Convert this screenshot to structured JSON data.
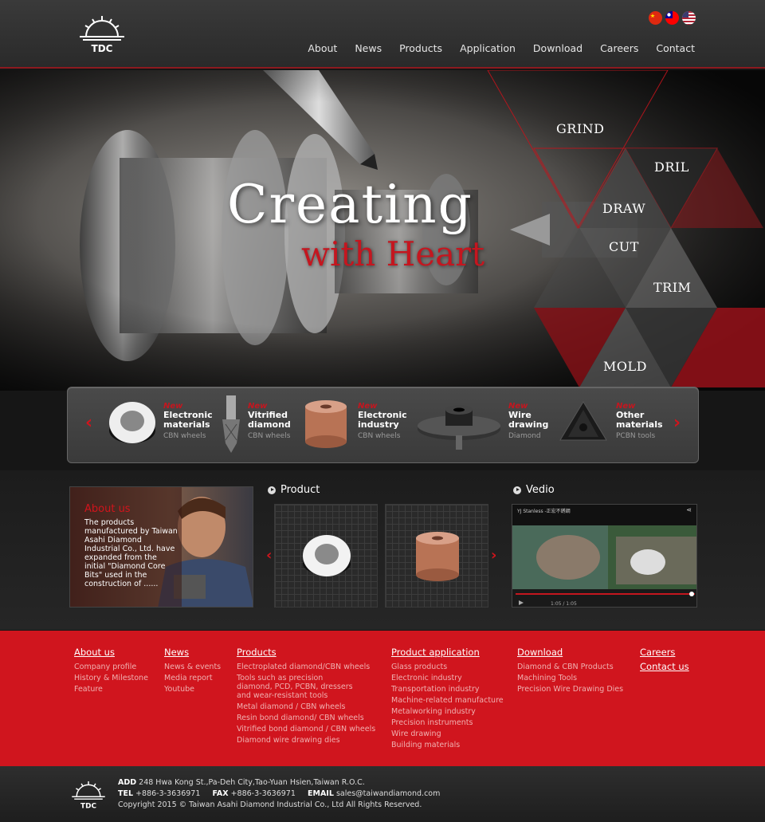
{
  "header": {
    "logo_text": "TDC",
    "nav": [
      "About",
      "News",
      "Products",
      "Application",
      "Download",
      "Careers",
      "Contact"
    ]
  },
  "hero": {
    "title": "Creating",
    "subtitle": "with Heart",
    "process_words": [
      "GRIND",
      "DRIL",
      "DRAW",
      "CUT",
      "TRIM",
      "MOLD"
    ]
  },
  "slider": {
    "prev": "‹",
    "next": "›",
    "new_label": "New",
    "items": [
      {
        "title_1": "Electronic",
        "title_2": "materials",
        "sub": "CBN wheels"
      },
      {
        "title_1": "Vitrified",
        "title_2": "diamond",
        "sub": "CBN wheels"
      },
      {
        "title_1": "Electronic",
        "title_2": "industry",
        "sub": "CBN wheels"
      },
      {
        "title_1": "Wire",
        "title_2": "drawing",
        "sub": "Diamond"
      },
      {
        "title_1": "Other",
        "title_2": "materials",
        "sub": "PCBN tools"
      }
    ]
  },
  "about": {
    "title": "About us",
    "text": "The products manufactured by Taiwan Asahi Diamond Industrial Co., Ltd. have expanded from the initial \"Diamond Core Bits\" used in the construction of ......"
  },
  "product_section": {
    "title": "Product",
    "prev": "‹",
    "next": "›"
  },
  "video_section": {
    "title": "Vedio",
    "video_title": "YJ Stanless -正宏不銹鋼",
    "time": "1:05 / 1:05"
  },
  "footer_nav": {
    "columns": [
      {
        "head": "About us",
        "links": [
          "Company profile",
          "History & Milestone",
          "Feature"
        ]
      },
      {
        "head": "News",
        "links": [
          "News & events",
          "Media report",
          "Youtube"
        ]
      },
      {
        "head": "Products",
        "links": [
          "Electroplated diamond/CBN wheels",
          "Tools such as precision",
          "diamond, PCD, PCBN, dressers",
          "and wear-resistant tools",
          "Metal diamond / CBN wheels",
          "Resin bond diamond/ CBN wheels",
          "Vitrified bond diamond / CBN wheels",
          "Diamond wire drawing dies"
        ]
      },
      {
        "head": "Product application",
        "links": [
          "Glass products",
          "Electronic industry",
          "Transportation industry",
          "Machine-related manufacture",
          "Metalworking industry",
          "Precision instruments",
          "Wire drawing",
          "Building materials"
        ]
      },
      {
        "head": "Download",
        "links": [
          "Diamond & CBN Products",
          "Machining Tools",
          "Precision Wire Drawing Dies"
        ]
      },
      {
        "head": "Careers",
        "links": []
      },
      {
        "head": "Contact us",
        "links": []
      }
    ]
  },
  "footer": {
    "add_label": "ADD",
    "address": "248 Hwa Kong St.,Pa-Deh City,Tao-Yuan Hsien,Taiwan R.O.C.",
    "tel_label": "TEL",
    "tel": "+886-3-3636971",
    "fax_label": "FAX",
    "fax": "+886-3-3636971",
    "email_label": "EMAIL",
    "email": "sales@taiwandiamond.com",
    "copyright": "Copyright 2015 © Taiwan Asahi Diamond Industrial Co., Ltd All Rights Reserved."
  },
  "colors": {
    "accent": "#d0151e",
    "dark": "#1a1a1a"
  }
}
